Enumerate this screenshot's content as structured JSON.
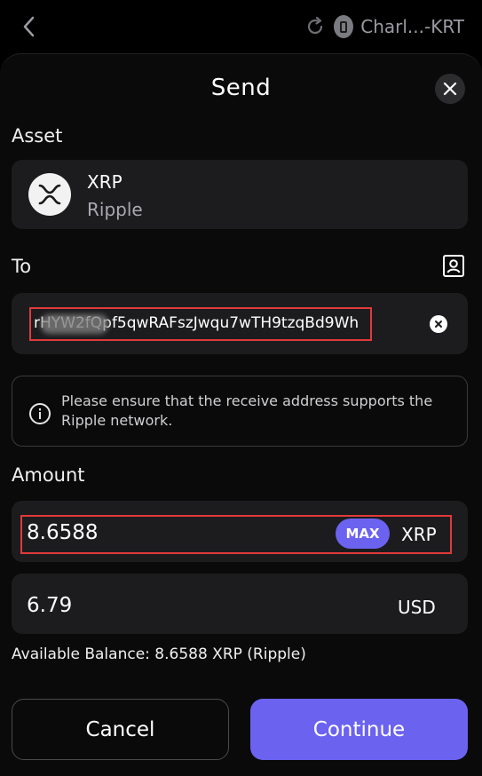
{
  "topbar": {
    "back_icon": "chevron-left-icon",
    "sync_icon": "sync-icon",
    "wallet_icon": "phone-wallet-icon",
    "wallet_name": "Charl...-KRT"
  },
  "dialog": {
    "title": "Send",
    "close_icon": "close-icon"
  },
  "asset": {
    "label": "Asset",
    "symbol": "XRP",
    "name": "Ripple",
    "icon": "xrp-logo-icon"
  },
  "to": {
    "label": "To",
    "contacts_icon": "address-book-icon",
    "address_value": "rHYW2fQpf5qwRAFszJwqu7wTH9tzqBd9Wh",
    "clear_icon": "clear-icon"
  },
  "notice": {
    "icon": "info-icon",
    "text": "Please ensure that the receive address supports the Ripple network."
  },
  "amount": {
    "label": "Amount",
    "value": "8.6588",
    "max_label": "MAX",
    "unit": "XRP",
    "fiat_value": "6.79",
    "fiat_unit": "USD",
    "balance_text": "Available Balance: 8.6588 XRP (Ripple)"
  },
  "actions": {
    "cancel_label": "Cancel",
    "continue_label": "Continue"
  },
  "colors": {
    "accent": "#6b63f0",
    "highlight": "#e03a3a",
    "field_bg": "#1c1c1e"
  }
}
